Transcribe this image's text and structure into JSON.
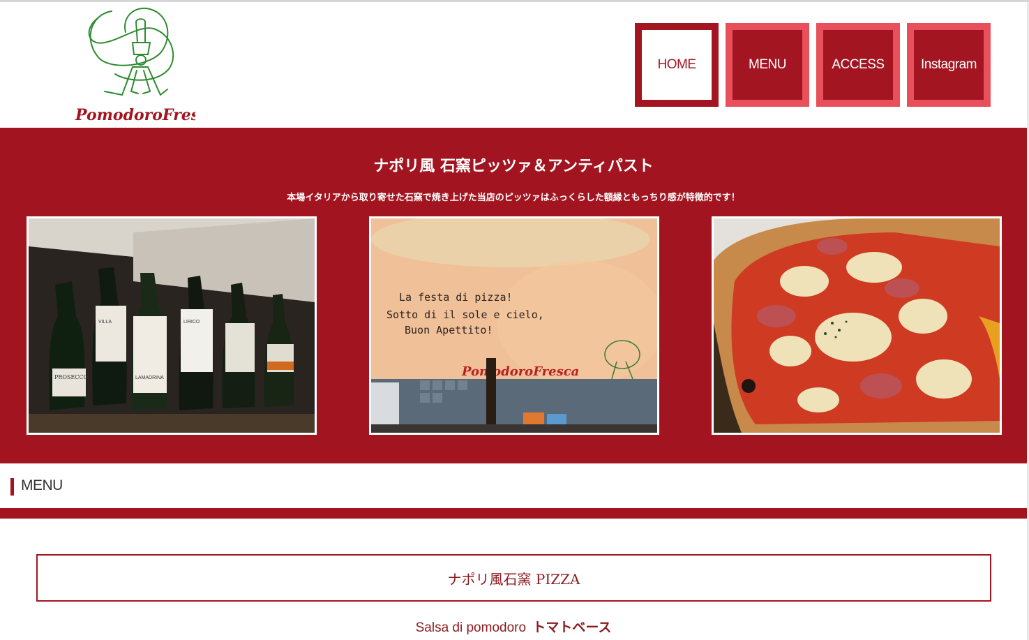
{
  "brand": {
    "name": "Pomodoro Fresca",
    "logo_text": "PomodoroFresca"
  },
  "nav": {
    "items": [
      {
        "label": "HOME",
        "active": true
      },
      {
        "label": "MENU",
        "active": false
      },
      {
        "label": "ACCESS",
        "active": false
      },
      {
        "label": "Instagram",
        "active": false
      }
    ]
  },
  "hero": {
    "title": "ナポリ風 石窯ピッツァ＆アンティパスト",
    "subtitle": "本場イタリアから取り寄せた石窯で焼き上げた当店のピッツァはふっくらした額縁ともっちり感が特徴的です！",
    "photos": [
      {
        "name": "wine-bottles-photo",
        "labels": [
          "PROSECCO",
          "VILLA",
          "LAMADRINA",
          "LIRICO"
        ]
      },
      {
        "name": "restaurant-wall-photo",
        "wall_text": [
          "La festa di pizza!",
          "Sotto di il sole e cielo,",
          "Buon Apettito!"
        ],
        "wall_logo": "PomodoroFresca"
      },
      {
        "name": "pizza-photo"
      }
    ]
  },
  "menu_heading": {
    "label": "MENU"
  },
  "section": {
    "title": "ナポリ風石窯 PIZZA",
    "subsection_it": "Salsa di pomodoro",
    "subsection_jp": "トマトベース"
  },
  "colors": {
    "brand_red": "#a21520",
    "nav_pink": "#e8505b",
    "logo_green": "#2e8b2e",
    "text_red": "#8b1a1f"
  }
}
